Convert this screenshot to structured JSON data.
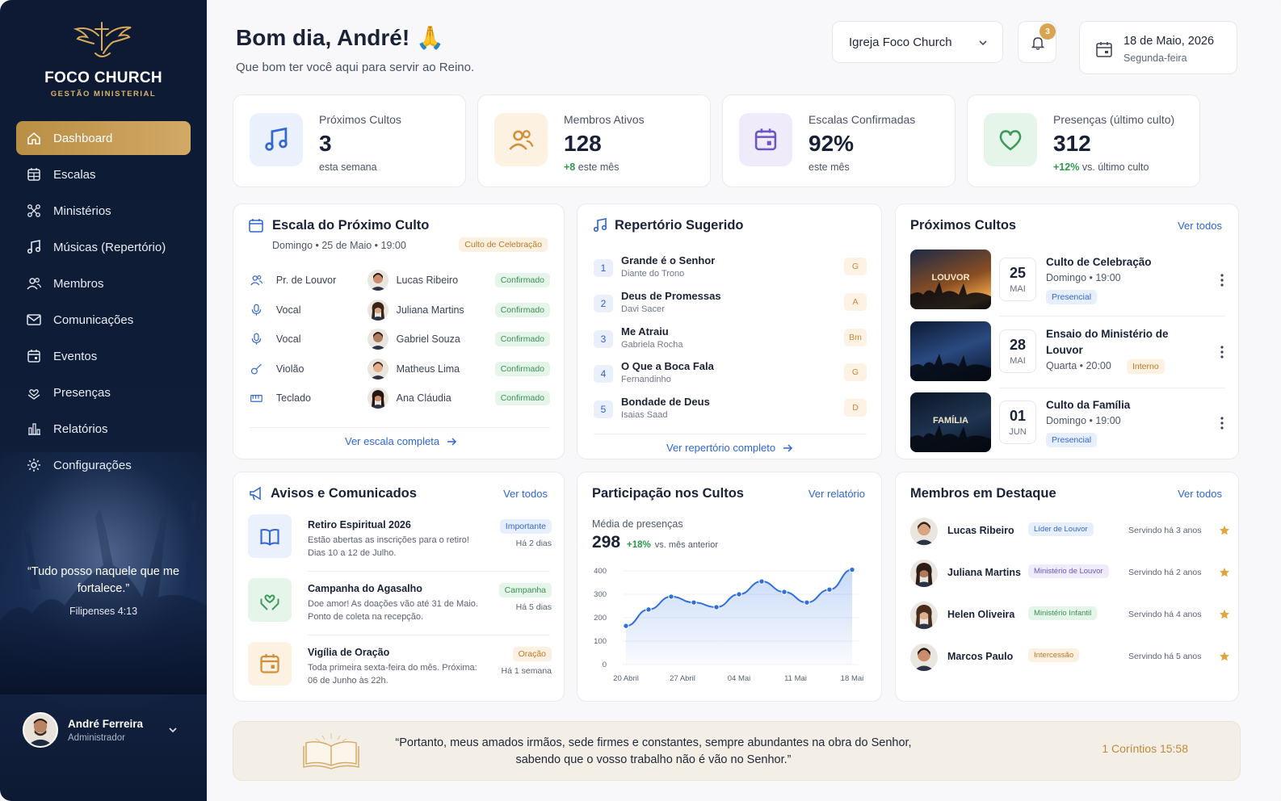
{
  "sidebar": {
    "brand": "FOCO CHURCH",
    "brand_sub": "GESTÃO MINISTERIAL",
    "nav": [
      {
        "label": "Dashboard",
        "icon": "home-icon",
        "active": true
      },
      {
        "label": "Escalas",
        "icon": "calendar-grid-icon"
      },
      {
        "label": "Ministérios",
        "icon": "network-icon"
      },
      {
        "label": "Músicas (Repertório)",
        "icon": "music-note-icon"
      },
      {
        "label": "Membros",
        "icon": "users-icon"
      },
      {
        "label": "Comunicações",
        "icon": "mail-icon"
      },
      {
        "label": "Eventos",
        "icon": "calendar-icon"
      },
      {
        "label": "Presenças",
        "icon": "hand-heart-icon"
      },
      {
        "label": "Relatórios",
        "icon": "bar-chart-icon"
      },
      {
        "label": "Configurações",
        "icon": "gear-icon"
      }
    ],
    "quote": "“Tudo posso naquele que me fortalece.”",
    "quote_ref": "Filipenses 4:13",
    "user": {
      "name": "André Ferreira",
      "role": "Administrador"
    }
  },
  "header": {
    "greeting": "Bom dia, André! 🙏",
    "subtitle": "Que bom ter você aqui para servir ao Reino.",
    "church": "Igreja Foco Church",
    "notifications": "3",
    "date": "18 de Maio, 2026",
    "weekday": "Segunda-feira"
  },
  "stats": [
    {
      "label": "Próximos Cultos",
      "value": "3",
      "delta": "",
      "sub": "esta semana",
      "color": "#eaf0fc",
      "icon": "music-note-icon"
    },
    {
      "label": "Membros Ativos",
      "value": "128",
      "delta": "+8",
      "sub": "este mês",
      "color": "#fdf1e2",
      "icon": "users-icon"
    },
    {
      "label": "Escalas Confirmadas",
      "value": "92%",
      "delta": "",
      "sub": "este mês",
      "color": "#efebfb",
      "icon": "calendar-icon"
    },
    {
      "label": "Presenças (último culto)",
      "value": "312",
      "delta": "+12%",
      "sub": "vs. último culto",
      "color": "#e6f5ea",
      "icon": "heart-icon"
    }
  ],
  "schedule": {
    "title": "Escala do Próximo Culto",
    "when": "Domingo • 25 de Maio • 19:00",
    "tag": "Culto de Celebração",
    "rows": [
      {
        "role": "Pr. de Louvor",
        "name": "Lucas Ribeiro",
        "status": "Confirmado"
      },
      {
        "role": "Vocal",
        "name": "Juliana Martins",
        "status": "Confirmado"
      },
      {
        "role": "Vocal",
        "name": "Gabriel Souza",
        "status": "Confirmado"
      },
      {
        "role": "Violão",
        "name": "Matheus Lima",
        "status": "Confirmado"
      },
      {
        "role": "Teclado",
        "name": "Ana Cláudia",
        "status": "Confirmado"
      }
    ],
    "link": "Ver escala completa"
  },
  "repertoire": {
    "title": "Repertório Sugerido",
    "songs": [
      {
        "num": "1",
        "title": "Grande é o Senhor",
        "artist": "Diante do Trono",
        "key": "G"
      },
      {
        "num": "2",
        "title": "Deus de Promessas",
        "artist": "Davi Sacer",
        "key": "A"
      },
      {
        "num": "3",
        "title": "Me Atraiu",
        "artist": "Gabriela Rocha",
        "key": "Bm"
      },
      {
        "num": "4",
        "title": "O Que a Boca Fala",
        "artist": "Fernandinho",
        "key": "G"
      },
      {
        "num": "5",
        "title": "Bondade de Deus",
        "artist": "Isaias Saad",
        "key": "D"
      }
    ],
    "link": "Ver repertório completo"
  },
  "upcoming": {
    "title": "Próximos Cultos",
    "link": "Ver todos",
    "events": [
      {
        "day": "25",
        "month": "MAI",
        "title": "Culto de Celebração",
        "when": "Domingo • 19:00",
        "tag": "Presencial",
        "img_text": "LOUVOR"
      },
      {
        "day": "28",
        "month": "MAI",
        "title": "Ensaio do Ministério de Louvor",
        "when": "Quarta • 20:00",
        "tag": "Interno",
        "img_text": ""
      },
      {
        "day": "01",
        "month": "JUN",
        "title": "Culto da Família",
        "when": "Domingo • 19:00",
        "tag": "Presencial",
        "img_text": "FAMÍLIA"
      }
    ]
  },
  "notices": {
    "title": "Avisos e Comunicados",
    "link": "Ver todos",
    "items": [
      {
        "title": "Retiro Espiritual 2026",
        "text": "Estão abertas as inscrições para o retiro! Dias 10 a 12 de Julho.",
        "tag": "Importante",
        "time": "Há 2 dias"
      },
      {
        "title": "Campanha do Agasalho",
        "text": "Doe amor! As doações vão até 31 de Maio. Ponto de coleta na recepção.",
        "tag": "Campanha",
        "time": "Há 5 dias"
      },
      {
        "title": "Vigília de Oração",
        "text": "Toda primeira sexta-feira do mês. Próxima: 06 de Junho às 22h.",
        "tag": "Oração",
        "time": "Há 1 semana"
      }
    ]
  },
  "participation": {
    "title": "Participação nos Cultos",
    "link": "Ver relatório",
    "avg_label": "Média de presenças",
    "avg_value": "298",
    "avg_delta": "+18%",
    "avg_sub": "vs. mês anterior"
  },
  "chart_data": {
    "type": "area",
    "title": "Participação nos Cultos",
    "xlabel": "",
    "ylabel": "",
    "ylim": [
      0,
      400
    ],
    "yticks": [
      "0",
      "100",
      "200",
      "300",
      "400"
    ],
    "xticks": [
      "20 Abril",
      "27 Abril",
      "04 Mai",
      "11 Mai",
      "18 Mai"
    ],
    "x": [
      0,
      1,
      2,
      3,
      4,
      5,
      6,
      7,
      8,
      9,
      10,
      11,
      12
    ],
    "values": [
      165,
      235,
      290,
      265,
      245,
      300,
      355,
      310,
      265,
      320,
      405
    ],
    "color": "#2f6fde"
  },
  "members": {
    "title": "Membros em Destaque",
    "link": "Ver todos",
    "items": [
      {
        "name": "Lucas Ribeiro",
        "role": "Líder de Louvor",
        "since": "Servindo há 3 anos",
        "tone": "blue"
      },
      {
        "name": "Juliana Martins",
        "role": "Ministério de Louvor",
        "since": "Servindo há 2 anos",
        "tone": "purple"
      },
      {
        "name": "Helen Oliveira",
        "role": "Ministério Infantil",
        "since": "Servindo há 4 anos",
        "tone": "green"
      },
      {
        "name": "Marcos Paulo",
        "role": "Intercessão",
        "since": "Servindo há 5 anos",
        "tone": "orange"
      }
    ]
  },
  "verse": {
    "text": "“Portanto, meus amados irmãos, sede firmes e constantes, sempre abundantes na obra do Senhor, sabendo que o vosso trabalho não é vão no Senhor.”",
    "ref": "1 Coríntios 15:58"
  },
  "colors": {
    "accent": "#c9a059",
    "sidebar": "#0f1d38",
    "link": "#2d66d4",
    "positive": "#2c9a4d"
  }
}
